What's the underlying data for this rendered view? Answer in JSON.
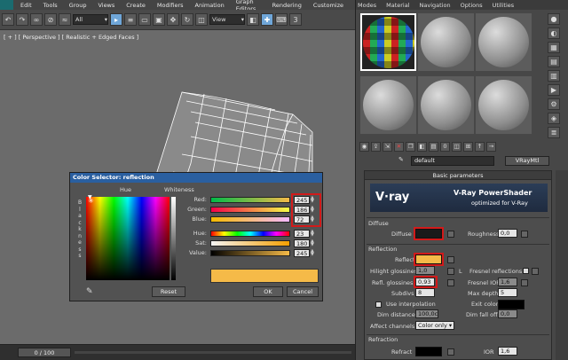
{
  "menu": [
    "Edit",
    "Tools",
    "Group",
    "Views",
    "Create",
    "Modifiers",
    "Animation",
    "Graph Editors",
    "Rendering",
    "Customize"
  ],
  "toolbar": {
    "selection_filter": "All",
    "coord_system": "View"
  },
  "viewport": {
    "label": "[ + ] [ Perspective ] [ Realistic + Edged Faces ]"
  },
  "timeline": {
    "frame": "0 / 100"
  },
  "color_selector": {
    "title": "Color Selector: reflection",
    "hue_label": "Hue",
    "whiteness_label": "Whiteness",
    "blackness_letters": [
      "B",
      "l",
      "a",
      "c",
      "k",
      "n",
      "e",
      "s",
      "s"
    ],
    "rows": [
      {
        "label": "Red:",
        "value": "245"
      },
      {
        "label": "Green:",
        "value": "186"
      },
      {
        "label": "Blue:",
        "value": "72"
      },
      {
        "label": "Hue:",
        "value": "23"
      },
      {
        "label": "Sat:",
        "value": "180"
      },
      {
        "label": "Value:",
        "value": "245"
      }
    ],
    "reset": "Reset",
    "ok": "OK",
    "cancel": "Cancel",
    "swatch_color": "#f5ba48"
  },
  "material_editor": {
    "menu": [
      "Modes",
      "Material",
      "Navigation",
      "Options",
      "Utilities"
    ],
    "material_name": "default",
    "material_type": "VRayMtl",
    "rollout": "Basic parameters",
    "banner": {
      "logo": "V·ray",
      "title": "V-Ray PowerShader",
      "subtitle": "optimized for V-Ray"
    },
    "diffuse": {
      "section": "Diffuse",
      "label": "Diffuse",
      "color": "#1a1a1a",
      "roughness_label": "Roughness",
      "roughness": "0,0"
    },
    "reflection": {
      "section": "Reflection",
      "reflect_label": "Reflect",
      "reflect_color": "#f5ba48",
      "hilight_label": "Hilight glossiness",
      "hilight": "1,0",
      "l_label": "L",
      "fresnel_label": "Fresnel reflections",
      "refl_gloss_label": "Refl. glossiness",
      "refl_gloss": "0,93",
      "fresnel_ior_label": "Fresnel IOR",
      "fresnel_ior": "1,6",
      "subdivs_label": "Subdivs",
      "subdivs": "8",
      "max_depth_label": "Max depth",
      "max_depth": "5",
      "use_interp_label": "Use interpolation",
      "exit_color_label": "Exit color",
      "dim_distance_label": "Dim distance",
      "dim_distance": "100,0c",
      "dim_falloff_label": "Dim fall off",
      "dim_falloff": "0,0",
      "affect_label": "Affect channels",
      "affect_value": "Color only"
    },
    "refraction": {
      "section": "Refraction",
      "refract_label": "Refract",
      "ior_label": "IOR",
      "ior": "1,6"
    }
  }
}
